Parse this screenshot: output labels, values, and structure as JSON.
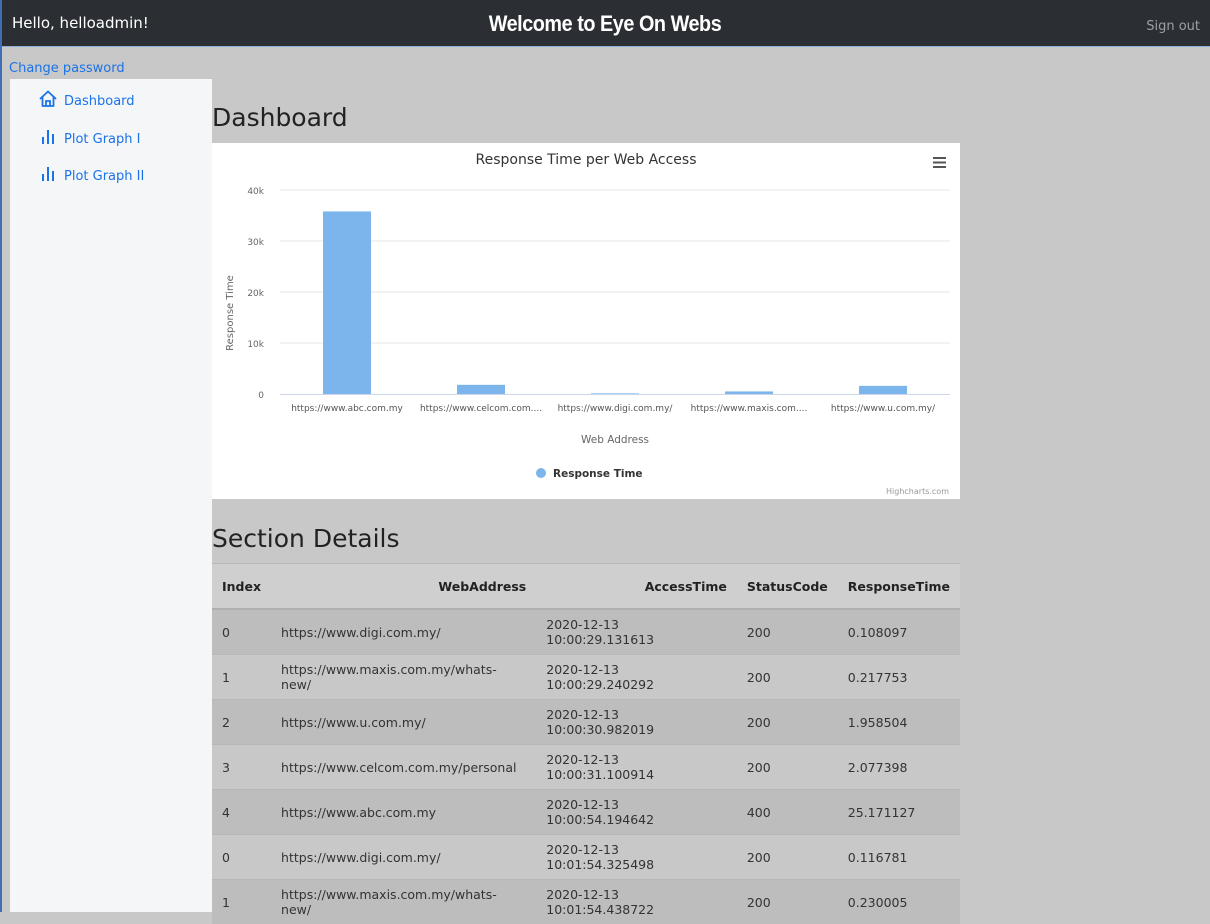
{
  "header": {
    "greeting": "Hello, helloadmin!",
    "title": "Welcome to Eye On Webs",
    "signout_label": "Sign out"
  },
  "account": {
    "change_password_label": "Change password"
  },
  "sidebar": {
    "items": [
      {
        "label": "Dashboard",
        "icon": "home-icon"
      },
      {
        "label": "Plot Graph I",
        "icon": "bar-chart-icon"
      },
      {
        "label": "Plot Graph II",
        "icon": "bar-chart-icon"
      }
    ]
  },
  "main": {
    "dashboard_title": "Dashboard",
    "section_title": "Section Details"
  },
  "chart_data": {
    "type": "bar",
    "title": "Response Time per Web Access",
    "xlabel": "Web Address",
    "ylabel": "Response Time",
    "categories": [
      "https://www.abc.com.my",
      "https://www.celcom.com....",
      "https://www.digi.com.my/",
      "https://www.maxis.com....",
      "https://www.u.com.my/"
    ],
    "series": [
      {
        "name": "Response Time",
        "values": [
          35800,
          1800,
          120,
          500,
          1600
        ]
      }
    ],
    "ylim": [
      0,
      40000
    ],
    "yticks": [
      "0",
      "10k",
      "20k",
      "30k",
      "40k"
    ],
    "grid": true,
    "legend": "bottom-center",
    "credits": "Highcharts.com",
    "menu_icon": "hamburger-menu-icon",
    "colors": {
      "bar": "#7cb5ec",
      "grid": "#e6e6e6",
      "axis": "#ccd6eb"
    }
  },
  "table": {
    "headers": [
      "Index",
      "WebAddress",
      "AccessTime",
      "StatusCode",
      "ResponseTime"
    ],
    "rows": [
      [
        "0",
        "https://www.digi.com.my/",
        "2020-12-13 10:00:29.131613",
        "200",
        "0.108097"
      ],
      [
        "1",
        "https://www.maxis.com.my/whats-new/",
        "2020-12-13 10:00:29.240292",
        "200",
        "0.217753"
      ],
      [
        "2",
        "https://www.u.com.my/",
        "2020-12-13 10:00:30.982019",
        "200",
        "1.958504"
      ],
      [
        "3",
        "https://www.celcom.com.my/personal",
        "2020-12-13 10:00:31.100914",
        "200",
        "2.077398"
      ],
      [
        "4",
        "https://www.abc.com.my",
        "2020-12-13 10:00:54.194642",
        "400",
        "25.171127"
      ],
      [
        "0",
        "https://www.digi.com.my/",
        "2020-12-13 10:01:54.325498",
        "200",
        "0.116781"
      ],
      [
        "1",
        "https://www.maxis.com.my/whats-new/",
        "2020-12-13 10:01:54.438722",
        "200",
        "0.230005"
      ]
    ]
  },
  "colors": {
    "topbar": "#2b2f33",
    "link": "#1a73e8",
    "page_bg": "#c8c8c8",
    "sidebar_bg": "#f4f6f8"
  }
}
